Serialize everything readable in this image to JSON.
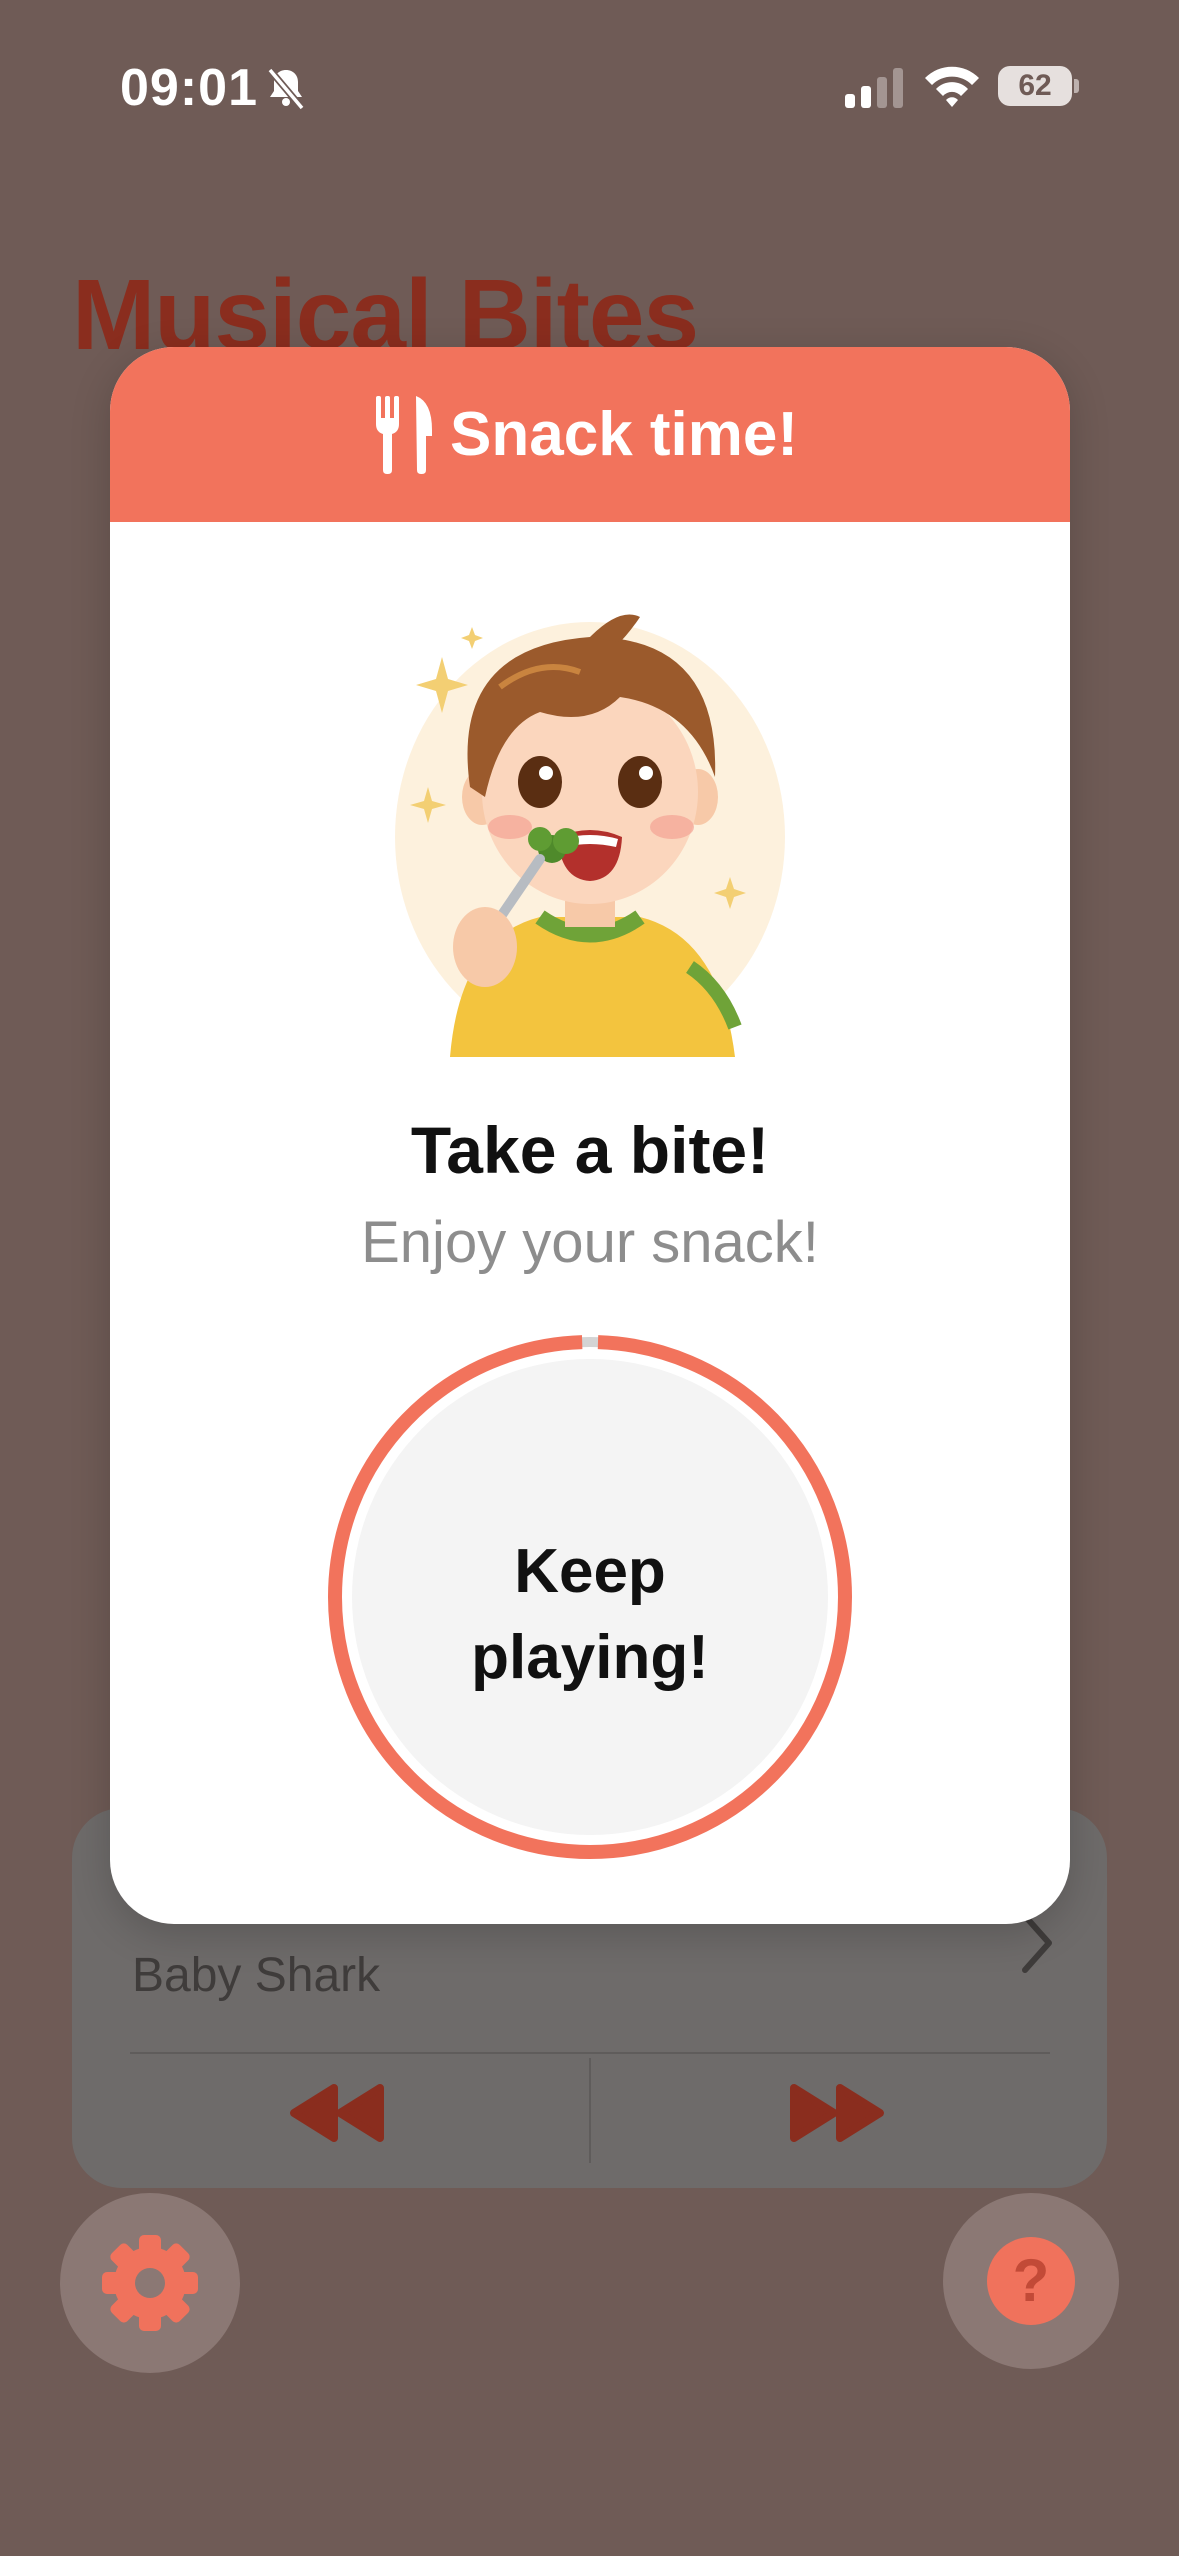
{
  "status_bar": {
    "time": "09:01",
    "battery": "62"
  },
  "app": {
    "title": "Musical Bites"
  },
  "player": {
    "song": "Baby Shark"
  },
  "modal": {
    "title": "Snack time!",
    "heading": "Take a bite!",
    "subheading": "Enjoy your snack!",
    "button_label": "Keep playing!",
    "timer_progress": 0.99
  },
  "colors": {
    "accent": "#f2735c",
    "background_dim": "#6f5b56",
    "title_text": "#8a2d1e"
  },
  "icons": [
    "bell-slash-icon",
    "signal-icon",
    "wifi-icon",
    "battery-icon",
    "utensils-icon",
    "rewind-icon",
    "fast-forward-icon",
    "gear-icon",
    "question-icon",
    "chevron-right-icon"
  ]
}
